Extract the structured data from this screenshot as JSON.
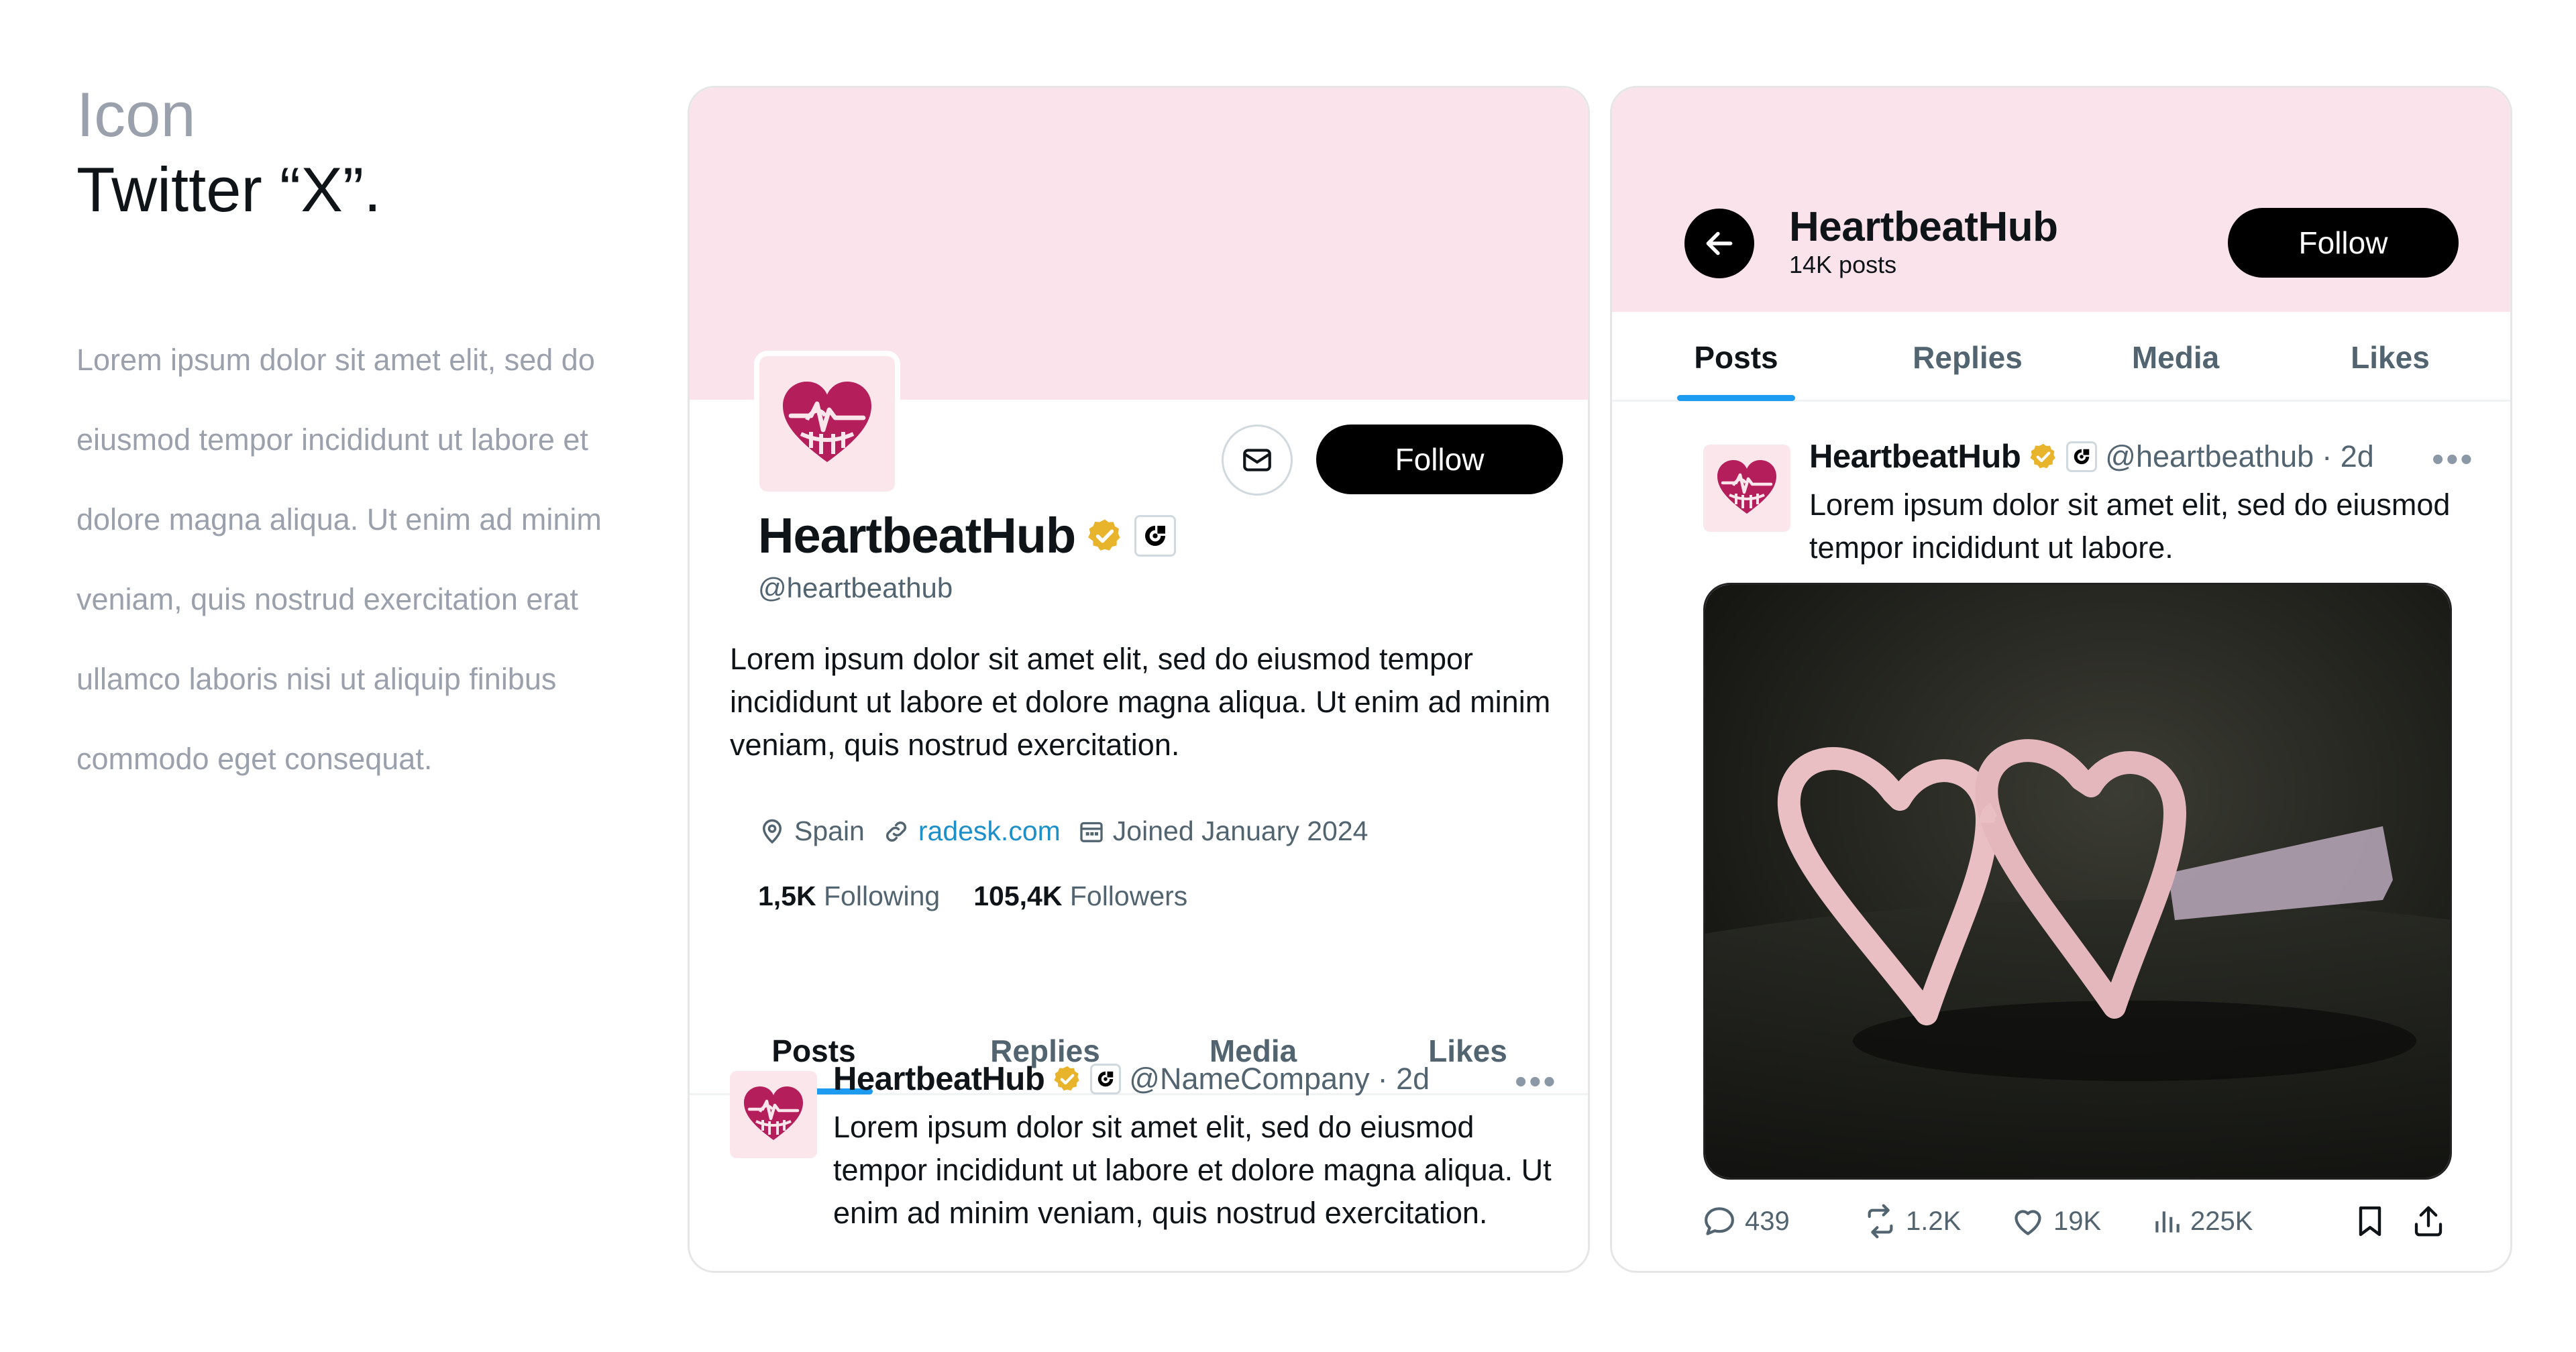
{
  "intro": {
    "kicker": "Icon",
    "headline": "Twitter “X”.",
    "body": "Lorem ipsum dolor sit amet elit, sed do eiusmod tempor incididunt ut labore et dolore magna aliqua. Ut enim ad minim veniam, quis nostrud exercitation erat ullamco laboris nisi ut aliquip finibus commodo eget consequat."
  },
  "colors": {
    "banner": "#fae3ea",
    "brand": "#b41e5a",
    "accent": "#1d9bf0",
    "link": "#1d8fc9",
    "verified": "#e7b42c"
  },
  "profile": {
    "name": "HeartbeatHub",
    "handle": "@heartbeathub",
    "follow_label": "Follow",
    "bio": "Lorem ipsum dolor sit amet elit, sed do eiusmod tempor incididunt ut labore et dolore magna aliqua. Ut enim ad minim veniam, quis nostrud exercitation.",
    "location": "Spain",
    "website": "radesk.com",
    "joined": "Joined January 2024",
    "following_count": "1,5K",
    "following_label": "Following",
    "followers_count": "105,4K",
    "followers_label": "Followers",
    "icons": [
      "mail-icon",
      "verified-badge-icon",
      "affiliate-badge-icon",
      "location-pin-icon",
      "link-icon",
      "calendar-icon"
    ]
  },
  "tabs": [
    {
      "label": "Posts",
      "active": true
    },
    {
      "label": "Replies",
      "active": false
    },
    {
      "label": "Media",
      "active": false
    },
    {
      "label": "Likes",
      "active": false
    }
  ],
  "post1": {
    "name": "HeartbeatHub",
    "handle": "@NameCompany",
    "time": "· 2d",
    "text": "Lorem ipsum dolor sit amet elit, sed do eiusmod tempor incididunt ut labore et dolore magna aliqua. Ut enim ad minim veniam, quis nostrud exercitation."
  },
  "header": {
    "title": "HeartbeatHub",
    "subtitle": "14K posts",
    "follow_label": "Follow"
  },
  "post2": {
    "name": "HeartbeatHub",
    "handle": "@heartbeathub",
    "time": "· 2d",
    "text": "Lorem ipsum dolor sit amet elit, sed do eiusmod tempor incididunt ut labore.",
    "image": "heart-shaped-glasses-photo",
    "actions": {
      "replies": "439",
      "reposts": "1.2K",
      "likes": "19K",
      "views": "225K"
    }
  }
}
